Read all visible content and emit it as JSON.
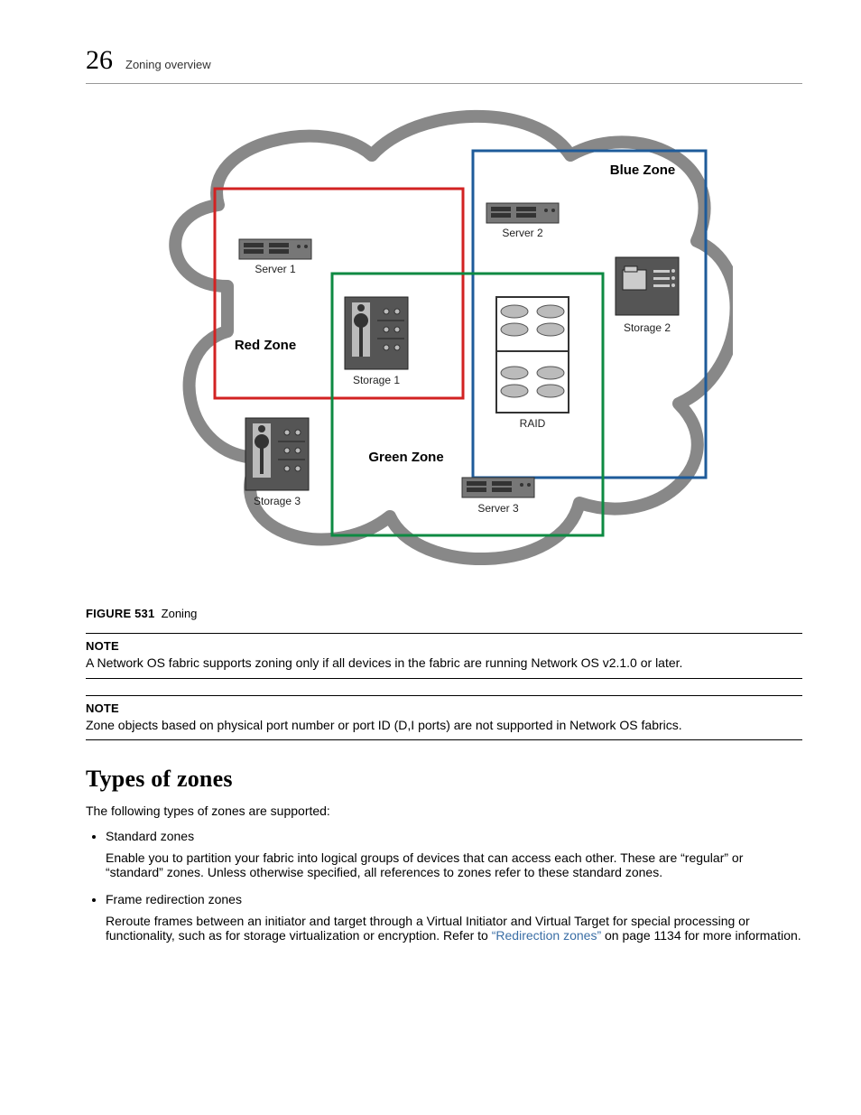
{
  "header": {
    "chapter": "26",
    "title": "Zoning overview"
  },
  "figure": {
    "lead": "FIGURE 531",
    "caption": "Zoning"
  },
  "diagram": {
    "zones": {
      "red": "Red Zone",
      "blue": "Blue Zone",
      "green": "Green Zone"
    },
    "devices": {
      "server1": "Server 1",
      "server2": "Server 2",
      "server3": "Server 3",
      "storage1": "Storage 1",
      "storage2": "Storage 2",
      "storage3": "Storage 3",
      "raid": "RAID"
    }
  },
  "notes": [
    {
      "label": "NOTE",
      "text": "A Network OS fabric supports zoning only if all devices in the fabric are running Network OS v2.1.0 or later."
    },
    {
      "label": "NOTE",
      "text": "Zone objects based on physical port number or port ID (D,I ports) are not supported in Network OS fabrics."
    }
  ],
  "section": {
    "heading": "Types of zones",
    "intro": "The following types of zones are supported:",
    "items": [
      {
        "name": "Standard zones",
        "desc": "Enable you to partition your fabric into logical groups of devices that can access each other. These are “regular” or “standard” zones. Unless otherwise specified, all references to zones refer to these standard zones."
      },
      {
        "name": "Frame redirection zones",
        "desc_pre": "Reroute frames between an initiator and target through a Virtual Initiator and Virtual Target for special processing or functionality, such as for storage virtualization or encryption. Refer to ",
        "link": "“Redirection zones”",
        "desc_post": " on page 1134 for more information."
      }
    ]
  }
}
